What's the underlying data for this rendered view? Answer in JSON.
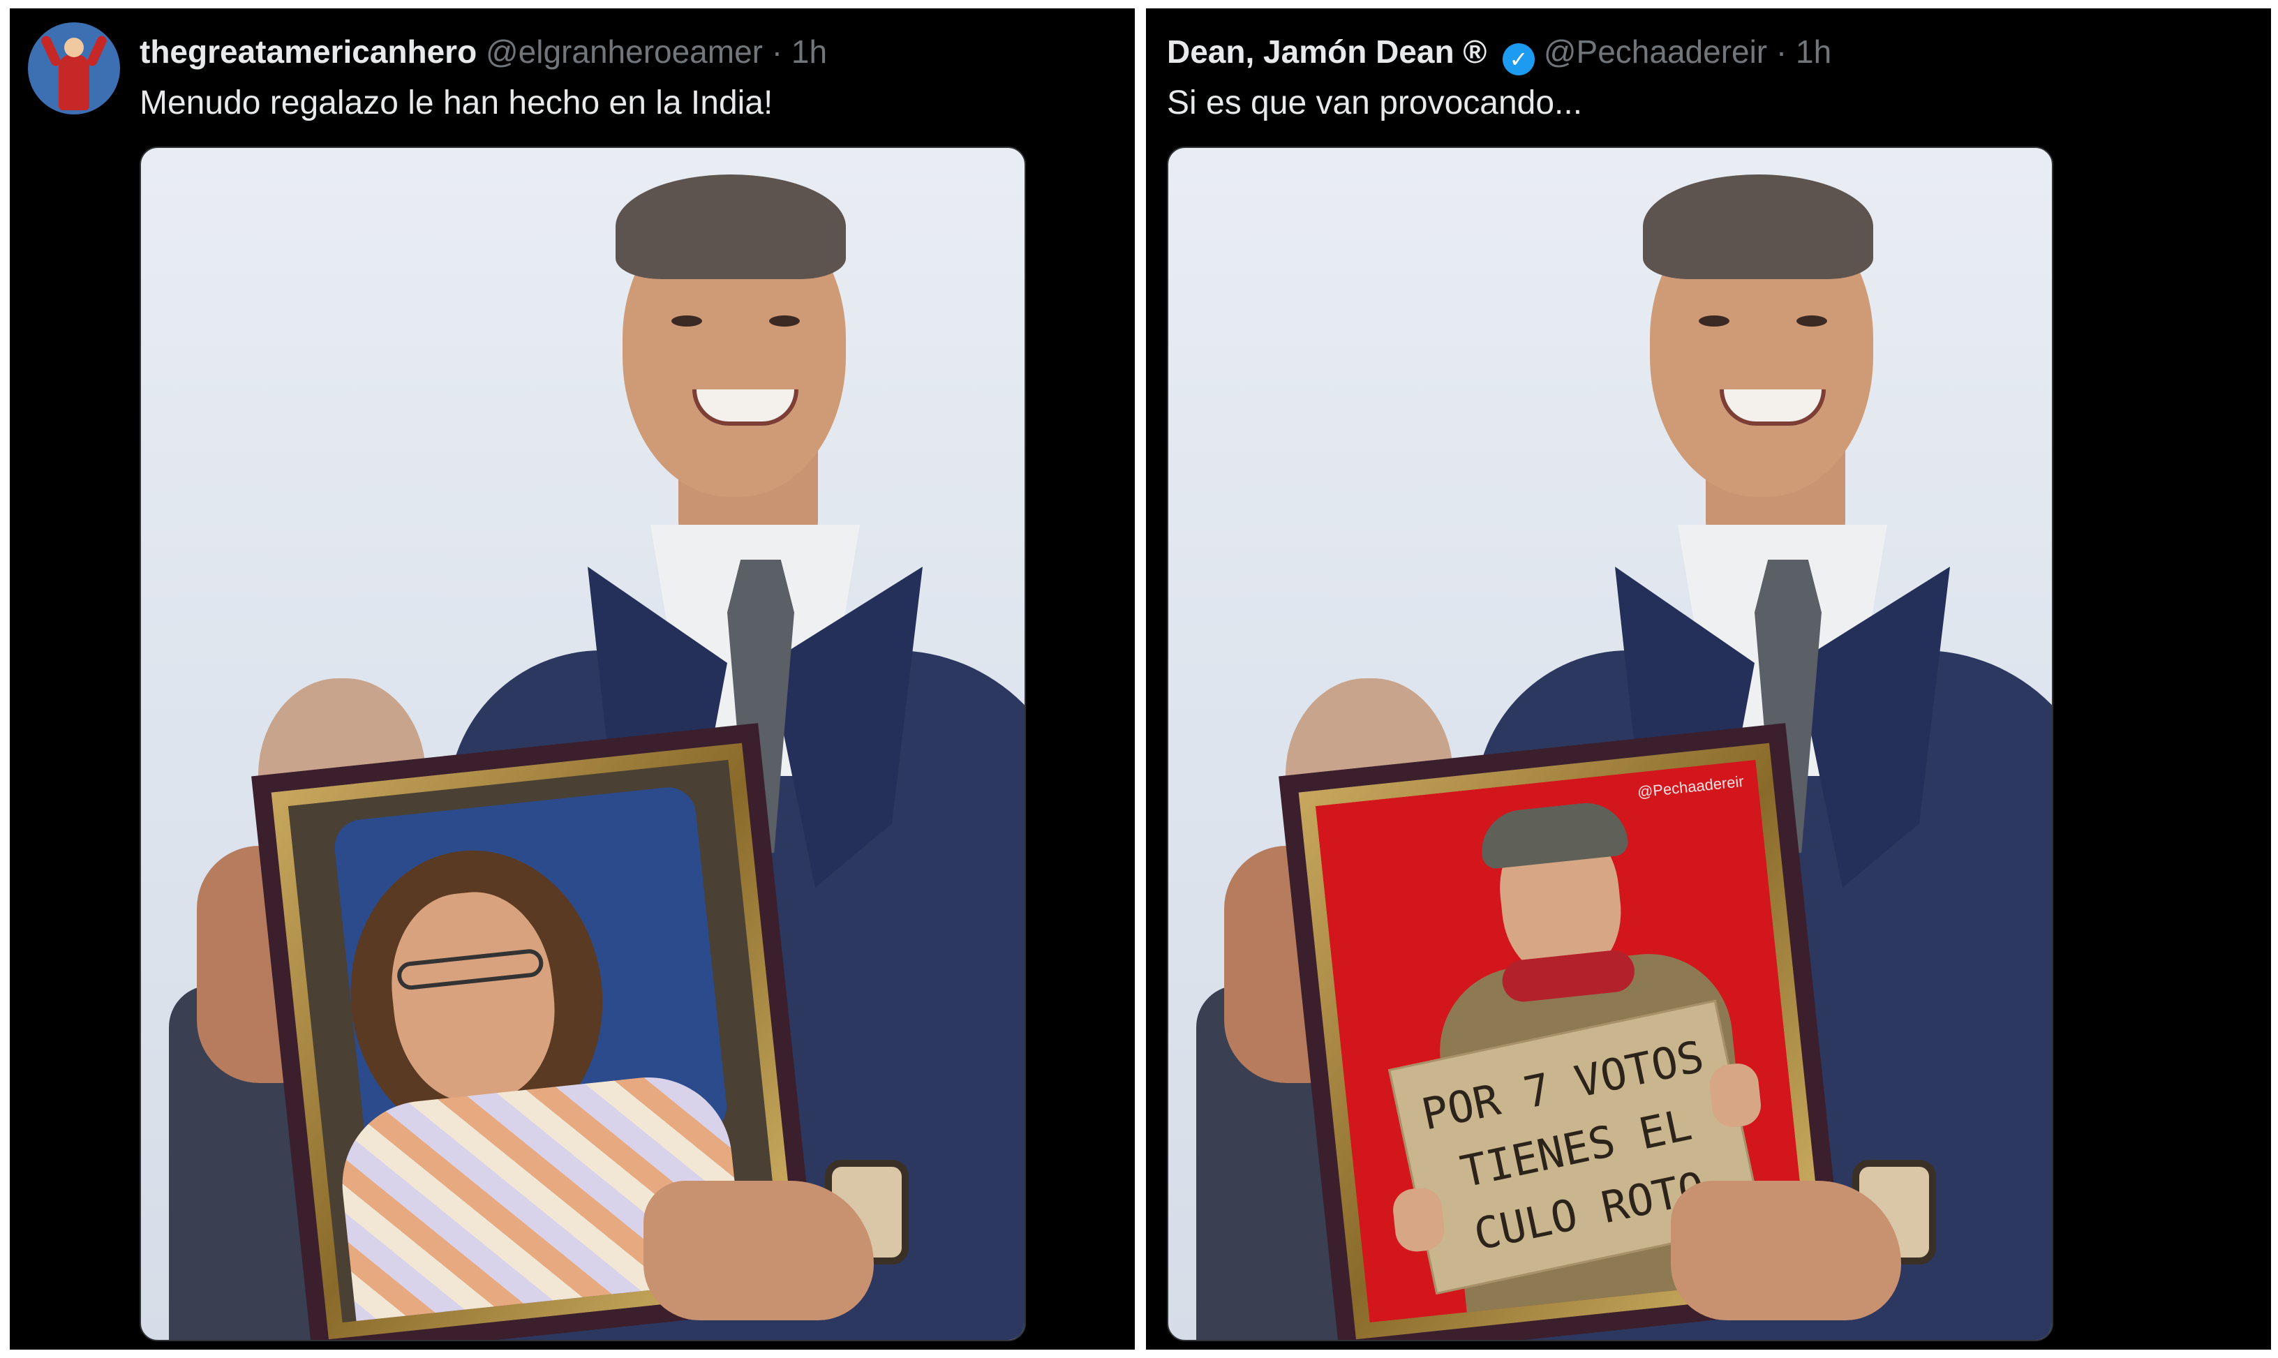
{
  "tweets": [
    {
      "display_name": "thegreatamericanhero",
      "handle": "@elgranheroeamer",
      "time": "· 1h",
      "text": "Menudo regalazo le han hecho en la India!"
    },
    {
      "display_name": "Dean, Jamón Dean ®",
      "verified": true,
      "handle": "@Pechaadereir",
      "time": "· 1h",
      "text": "Si es que van provocando...",
      "image_credit": "@Pechaadereir",
      "sign_lines": [
        "POR 7 VOTOS",
        "TIENES EL",
        "CULO ROTO"
      ]
    }
  ],
  "colors": {
    "panel_bg": "#000000",
    "name_text": "#e7e9ea",
    "meta_text": "#71767b",
    "verified_badge": "#1d9bf0",
    "poster_red": "#d2161c"
  },
  "icons": {
    "verified": "verified-badge-icon"
  }
}
